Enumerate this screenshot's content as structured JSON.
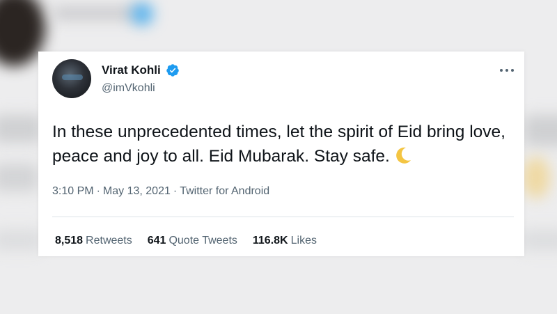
{
  "tweet": {
    "author": {
      "display_name": "Virat Kohli",
      "handle": "@imVkohli",
      "verified": true,
      "verified_color": "#1d9bf0"
    },
    "text": "In these unprecedented times, let the spirit of Eid bring love, peace and joy to all. Eid Mubarak. Stay safe.",
    "emoji": "crescent-moon-icon",
    "time": "3:10 PM",
    "date": "May 13, 2021",
    "source": "Twitter for Android",
    "separator": "·",
    "stats": {
      "retweets_count": "8,518",
      "retweets_label": "Retweets",
      "quote_count": "641",
      "quote_label": "Quote Tweets",
      "likes_count": "116.8K",
      "likes_label": "Likes"
    }
  },
  "colors": {
    "primary_text": "#0f1419",
    "secondary_text": "#536471",
    "moon": "#f4c542"
  }
}
